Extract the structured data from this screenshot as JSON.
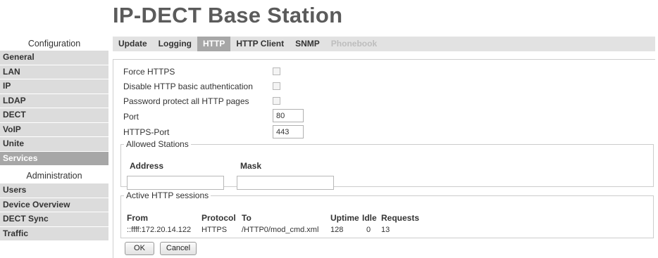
{
  "header": {
    "title": "IP-DECT Base Station"
  },
  "sidebar": {
    "config_heading": "Configuration",
    "config_items": [
      "General",
      "LAN",
      "IP",
      "LDAP",
      "DECT",
      "VoIP",
      "Unite",
      "Services"
    ],
    "active_item": "Services",
    "admin_heading": "Administration",
    "admin_items": [
      "Users",
      "Device Overview",
      "DECT Sync",
      "Traffic"
    ]
  },
  "tabs": {
    "items": [
      "Update",
      "Logging",
      "HTTP",
      "HTTP Client",
      "SNMP",
      "Phonebook"
    ],
    "active": "HTTP",
    "disabled": "Phonebook"
  },
  "form": {
    "force_https_label": "Force HTTPS",
    "disable_basic_auth_label": "Disable HTTP basic authentication",
    "password_protect_label": "Password protect all HTTP pages",
    "port_label": "Port",
    "port_value": "80",
    "https_port_label": "HTTPS-Port",
    "https_port_value": "443"
  },
  "allowed_stations": {
    "legend": "Allowed Stations",
    "address_header": "Address",
    "mask_header": "Mask",
    "address_value": "",
    "mask_value": ""
  },
  "sessions": {
    "legend": "Active HTTP sessions",
    "headers": {
      "from": "From",
      "protocol": "Protocol",
      "to": "To",
      "uptime": "Uptime",
      "idle": "Idle",
      "requests": "Requests"
    },
    "rows": [
      {
        "from": "::ffff:172.20.14.122",
        "protocol": "HTTPS",
        "to": "/HTTP0/mod_cmd.xml",
        "uptime": "128",
        "idle": "0",
        "requests": "13"
      }
    ]
  },
  "buttons": {
    "ok": "OK",
    "cancel": "Cancel"
  },
  "colors": {
    "active_bg": "#a7a7a7",
    "item_bg": "#dcdcdc",
    "title": "#5b5b5b"
  }
}
